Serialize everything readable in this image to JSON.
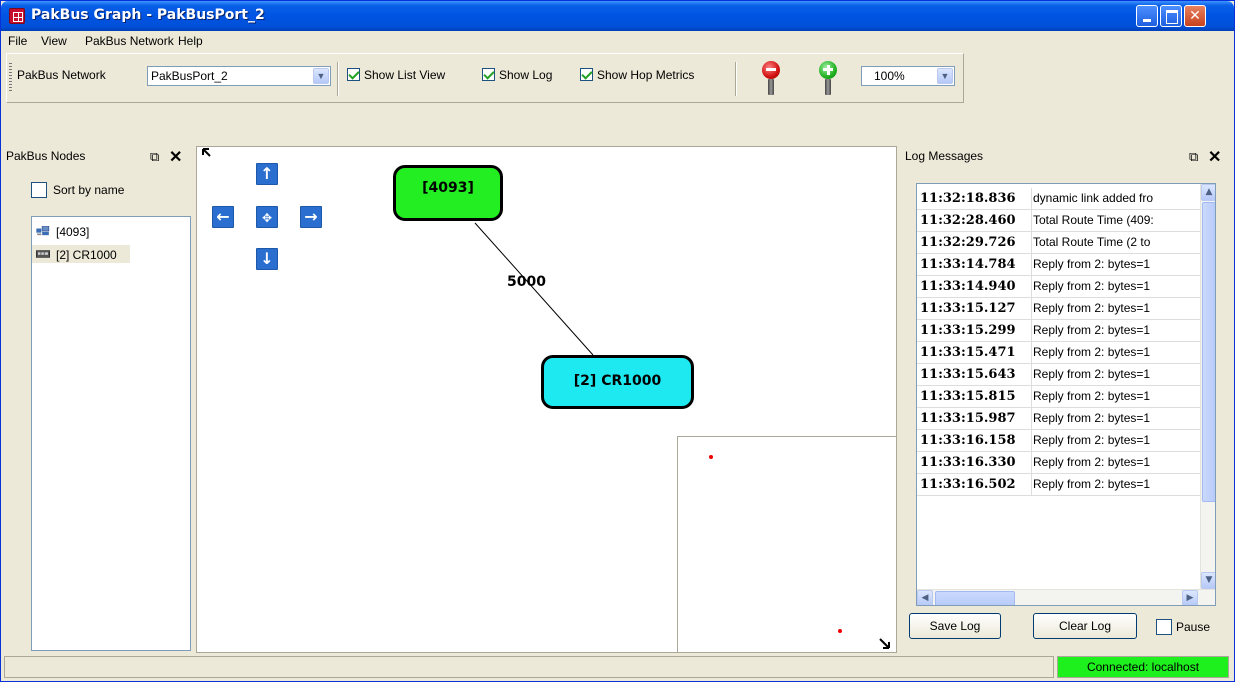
{
  "window": {
    "title": "PakBus Graph - PakBusPort_2"
  },
  "menu": [
    "File",
    "View",
    "PakBus Network",
    "Help"
  ],
  "toolbar": {
    "network_label": "PakBus Network",
    "network_value": "PakBusPort_2",
    "show_list_view": {
      "label": "Show List View",
      "checked": true
    },
    "show_log": {
      "label": "Show Log",
      "checked": true
    },
    "show_hop_metrics": {
      "label": "Show Hop Metrics",
      "checked": true
    },
    "zoom_out_icon": "zoom-out-pin-icon",
    "zoom_in_icon": "zoom-in-pin-icon",
    "zoom_value": "100%"
  },
  "nodes_panel": {
    "title": "PakBus Nodes",
    "sort_by_name": {
      "label": "Sort by name",
      "checked": false
    },
    "items": [
      {
        "label": "[4093]",
        "icon": "network-computer-icon"
      },
      {
        "label": "[2] CR1000",
        "icon": "datalogger-icon",
        "selected": true
      }
    ]
  },
  "graph": {
    "nodes": [
      {
        "label": "[4093]",
        "color": "#22ee22"
      },
      {
        "label": "[2] CR1000",
        "color": "#1ee8f0"
      }
    ],
    "edge_label": "5000"
  },
  "log_panel": {
    "title": "Log Messages",
    "rows": [
      {
        "time": "11:32:18.836",
        "msg": "dynamic link added fro"
      },
      {
        "time": "11:32:28.460",
        "msg": "Total Route Time (409:"
      },
      {
        "time": "11:32:29.726",
        "msg": "Total Route Time (2 to"
      },
      {
        "time": "11:33:14.784",
        "msg": "Reply from 2: bytes=1"
      },
      {
        "time": "11:33:14.940",
        "msg": "Reply from 2: bytes=1"
      },
      {
        "time": "11:33:15.127",
        "msg": "Reply from 2: bytes=1"
      },
      {
        "time": "11:33:15.299",
        "msg": "Reply from 2: bytes=1"
      },
      {
        "time": "11:33:15.471",
        "msg": "Reply from 2: bytes=1"
      },
      {
        "time": "11:33:15.643",
        "msg": "Reply from 2: bytes=1"
      },
      {
        "time": "11:33:15.815",
        "msg": "Reply from 2: bytes=1"
      },
      {
        "time": "11:33:15.987",
        "msg": "Reply from 2: bytes=1"
      },
      {
        "time": "11:33:16.158",
        "msg": "Reply from 2: bytes=1"
      },
      {
        "time": "11:33:16.330",
        "msg": "Reply from 2: bytes=1"
      },
      {
        "time": "11:33:16.502",
        "msg": "Reply from 2: bytes=1"
      }
    ],
    "save_label": "Save Log",
    "clear_label": "Clear Log",
    "pause": {
      "label": "Pause",
      "checked": false
    }
  },
  "status": {
    "connection": "Connected: localhost",
    "connection_color": "#1ef01e"
  }
}
